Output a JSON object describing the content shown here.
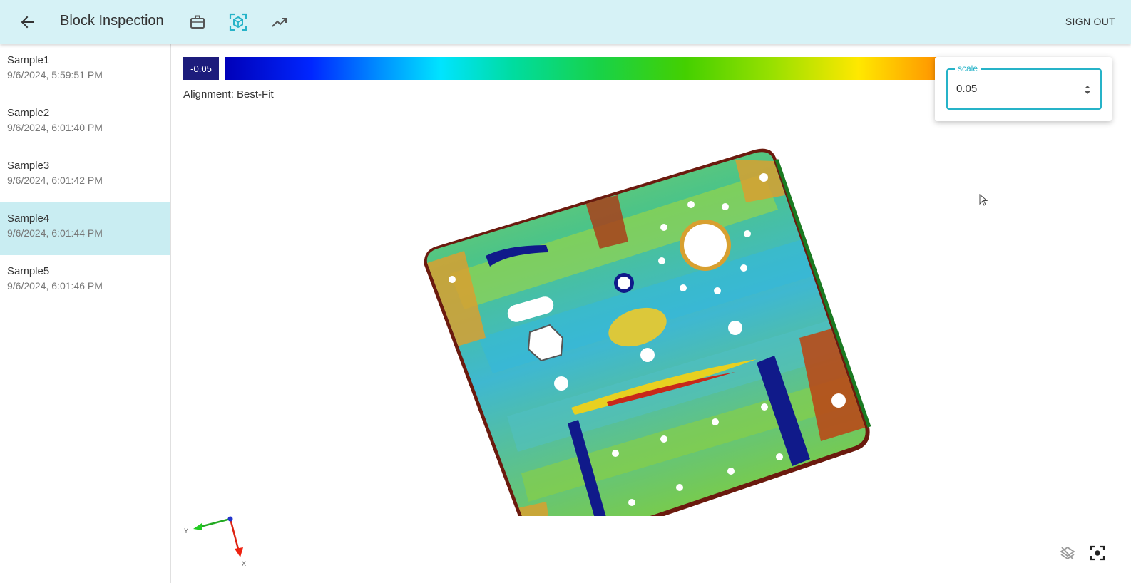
{
  "header": {
    "title": "Block Inspection",
    "sign_out_label": "SIGN OUT",
    "nav_icons": [
      "briefcase-icon",
      "scan-3d-icon",
      "trending-up-icon"
    ],
    "active_nav": "scan-3d-icon"
  },
  "samples": [
    {
      "name": "Sample1",
      "time": "9/6/2024, 5:59:51 PM"
    },
    {
      "name": "Sample2",
      "time": "9/6/2024, 6:01:40 PM"
    },
    {
      "name": "Sample3",
      "time": "9/6/2024, 6:01:42 PM"
    },
    {
      "name": "Sample4",
      "time": "9/6/2024, 6:01:44 PM"
    },
    {
      "name": "Sample5",
      "time": "9/6/2024, 6:01:46 PM"
    }
  ],
  "selected_sample": "Sample4",
  "viewer": {
    "colorbar_min": "-0.05",
    "alignment_text": "Alignment: Best-Fit",
    "scale": {
      "label": "scale",
      "value": "0.05"
    },
    "axes": {
      "y_label": "Y",
      "x_label": "X"
    },
    "tools": [
      "layers-off-icon",
      "focus-frame-icon"
    ]
  },
  "colors": {
    "header_bg": "#d6f2f6",
    "accent": "#26b3c8",
    "selected_row": "#c9edf2"
  }
}
